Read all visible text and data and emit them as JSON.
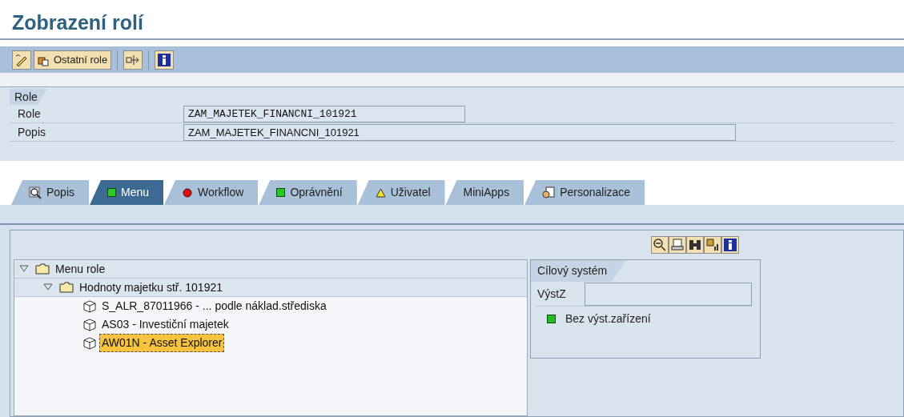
{
  "window": {
    "title": "Zobrazení rolí"
  },
  "toolbar": [
    {
      "kind": "edit"
    },
    {
      "kind": "button",
      "label": "Ostatní role"
    },
    {
      "kind": "separator"
    },
    {
      "kind": "transport"
    },
    {
      "kind": "separator"
    },
    {
      "kind": "info"
    }
  ],
  "role_group": {
    "title": "Role",
    "fields": [
      {
        "label": "Role",
        "value": "ZAM_MAJETEK_FINANCNI_101921",
        "kind": "mono"
      },
      {
        "label": "Popis",
        "value": "ZAM_MAJETEK_FINANCNI_101921",
        "kind": "wide"
      }
    ]
  },
  "tabs": [
    {
      "label": "Popis",
      "kind": "search",
      "selected": false
    },
    {
      "label": "Menu",
      "kind": "square",
      "selected": true
    },
    {
      "label": "Workflow",
      "kind": "ball",
      "selected": false
    },
    {
      "label": "Oprávnění",
      "kind": "square",
      "selected": false
    },
    {
      "label": "Uživatel",
      "kind": "warning",
      "selected": false
    },
    {
      "label": "MiniApps",
      "kind": "plain",
      "selected": false
    },
    {
      "label": "Personalizace",
      "kind": "personal",
      "selected": false
    }
  ],
  "panel_toolbar": [
    {
      "kind": "zoom-out"
    },
    {
      "kind": "print"
    },
    {
      "kind": "find"
    },
    {
      "kind": "grid"
    },
    {
      "kind": "info"
    }
  ],
  "tree": [
    {
      "label": "Menu role",
      "kind": "folder",
      "expanded": true,
      "selected": false,
      "children": [
        {
          "label": "Hodnoty majetku  stř. 101921",
          "kind": "folder",
          "expanded": true,
          "selected": false,
          "children": [
            {
              "label": "S_ALR_87011966 - ... podle náklad.střediska",
              "kind": "transaction",
              "selected": false
            },
            {
              "label": "AS03 - Investiční majetek",
              "kind": "transaction",
              "selected": false
            },
            {
              "label": "AW01N - Asset Explorer",
              "kind": "transaction",
              "selected": true
            }
          ]
        }
      ]
    }
  ],
  "target_system": {
    "title": "Cílový systém",
    "field_label": "VýstZ",
    "status": {
      "label": "Bez výst.zařízení",
      "color": "#22bb22"
    }
  }
}
